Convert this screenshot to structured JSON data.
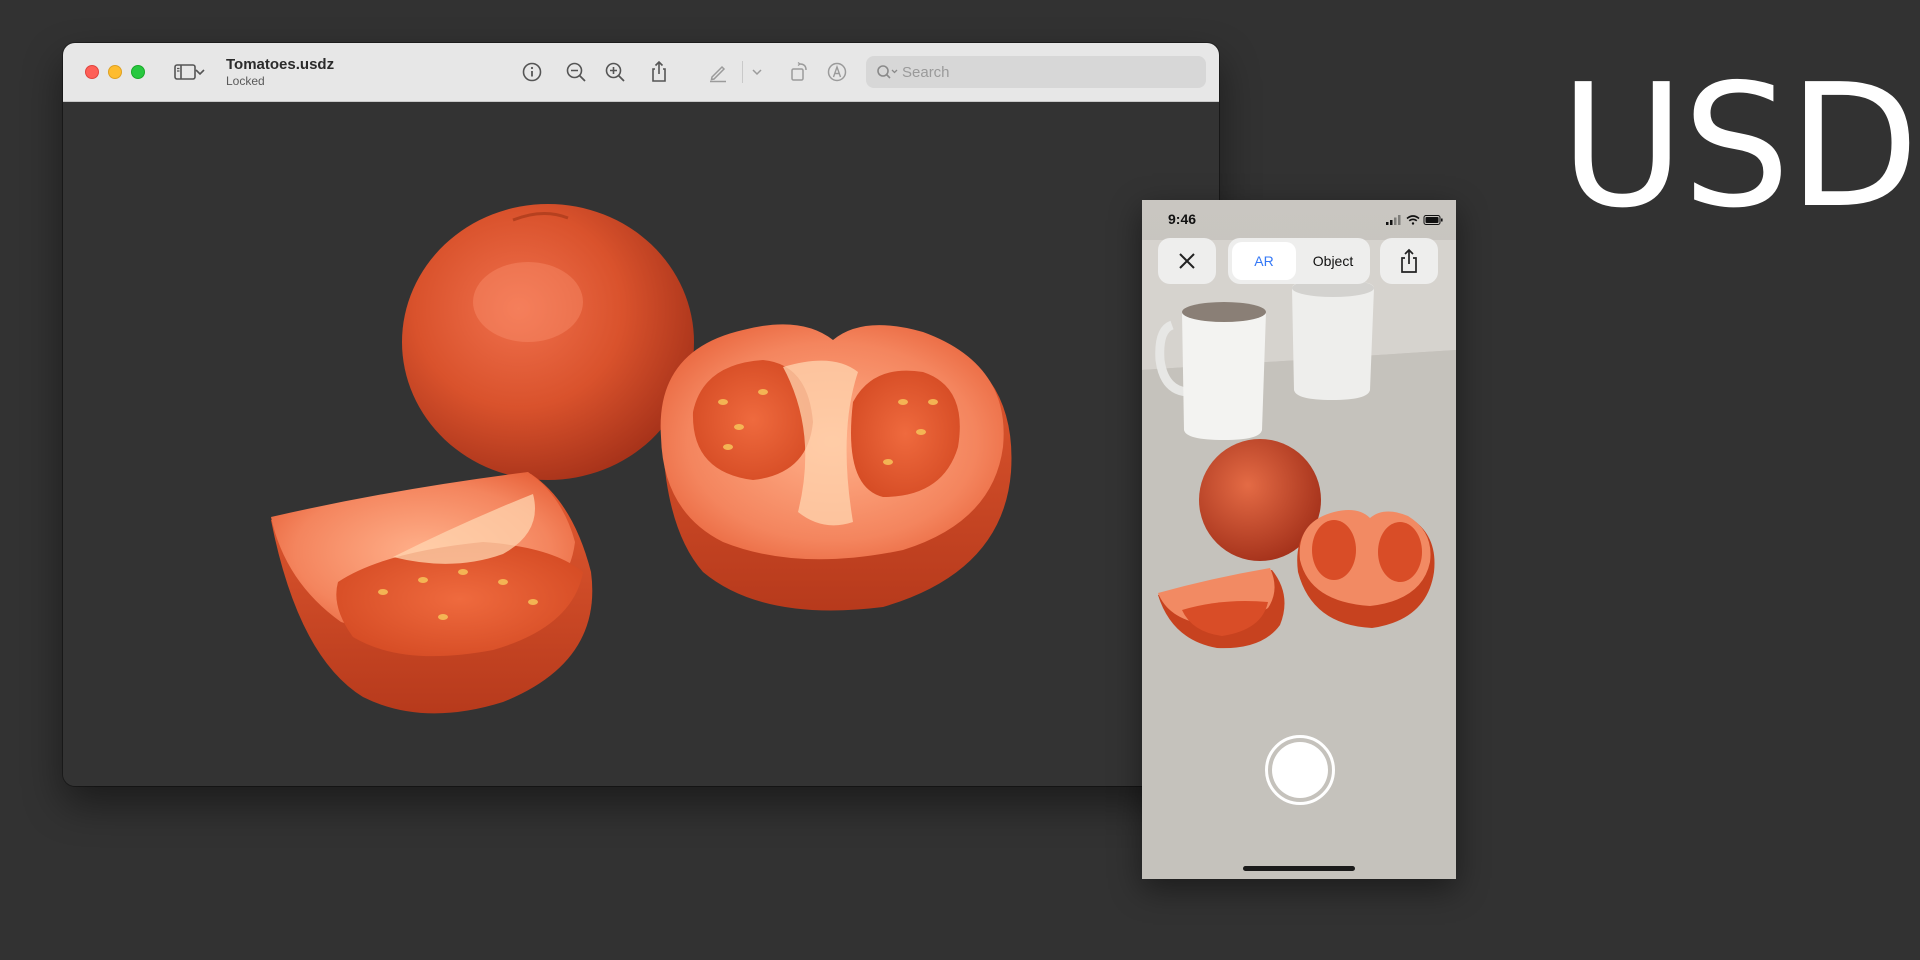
{
  "window": {
    "title": "Tomatoes.usdz",
    "subtitle": "Locked",
    "search_placeholder": "Search",
    "toolbar_icons": [
      "sidebar-icon",
      "chevron-down-icon",
      "info-icon",
      "zoom-out-icon",
      "zoom-in-icon",
      "share-icon",
      "markup-pen-icon",
      "chevron-down-icon",
      "rotate-icon",
      "annotate-icon",
      "search-icon"
    ]
  },
  "phone": {
    "time": "9:46",
    "mode_ar": "AR",
    "mode_object": "Object",
    "status_icons": [
      "signal-icon",
      "wifi-icon",
      "battery-icon"
    ]
  },
  "brand": {
    "title": "USDz"
  },
  "colors": {
    "background": "#323232",
    "toolbar": "#e7e7e7",
    "accent_blue": "#3478f6",
    "tomato": "#d8532b"
  }
}
